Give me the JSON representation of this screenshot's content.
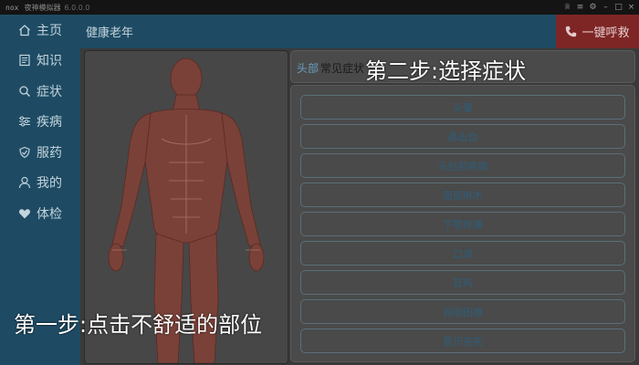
{
  "titlebar": {
    "app_name": "夜神模拟器",
    "version": "6.0.0.0"
  },
  "header": {
    "title": "健康老年",
    "sos_label": "一键呼救"
  },
  "sidebar": {
    "items": [
      {
        "label": "主页",
        "icon": "home-icon"
      },
      {
        "label": "知识",
        "icon": "book-icon"
      },
      {
        "label": "症状",
        "icon": "search-icon"
      },
      {
        "label": "疾病",
        "icon": "sliders-icon"
      },
      {
        "label": "服药",
        "icon": "shield-icon"
      },
      {
        "label": "我的",
        "icon": "user-icon"
      },
      {
        "label": "体检",
        "icon": "heart-icon"
      }
    ]
  },
  "symptoms": {
    "body_part": "头部",
    "header_suffix": "常见症状",
    "items": [
      "头晕",
      "鼻出血",
      "头后部疼痛",
      "面部麻木",
      "下颚疼痛",
      "口渴",
      "耳鸣",
      "吞咽困难",
      "意识丧失"
    ]
  },
  "captions": {
    "step1": "第一步:点击不舒适的部位",
    "step2": "第二步:选择症状"
  },
  "colors": {
    "sidebar": "#1e4b63",
    "sos": "#7e2626",
    "symptom_text": "#2e5d78"
  }
}
